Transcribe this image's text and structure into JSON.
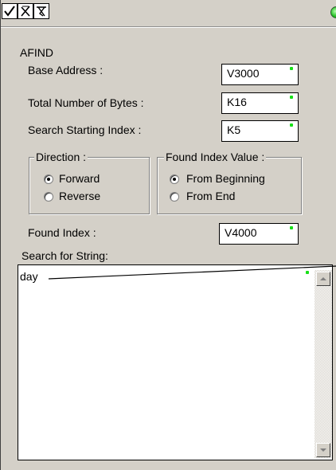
{
  "toolbar": {
    "accept_icon": "checkmark-icon",
    "cancel_icon": "x-icon",
    "help_icon": "help-tool-icon",
    "status_color": "#25c025"
  },
  "instruction": {
    "name": "AFIND"
  },
  "fields": {
    "base_address_label": "Base Address :",
    "base_address_value": "V3000",
    "total_bytes_label": "Total Number of Bytes :",
    "total_bytes_value": "K16",
    "search_start_label": "Search Starting Index :",
    "search_start_value": "K5",
    "found_index_label": "Found Index :",
    "found_index_value": "V4000"
  },
  "direction": {
    "title": "Direction :",
    "forward_label": "Forward",
    "reverse_label": "Reverse",
    "selected": "Forward"
  },
  "found_index_value_group": {
    "title": "Found Index Value :",
    "from_beginning_label": "From Beginning",
    "from_end_label": "From End",
    "selected": "From Beginning"
  },
  "search_string": {
    "label": "Search for String:",
    "value": "day"
  },
  "colors": {
    "dialog_bg": "#d4d0c8",
    "indicator_dot": "#18e018"
  }
}
